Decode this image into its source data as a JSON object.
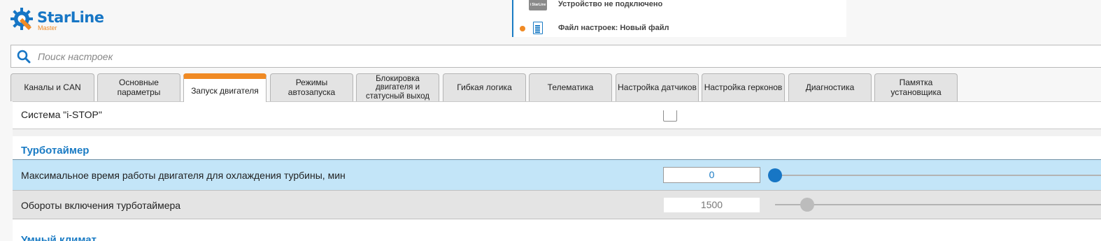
{
  "app": {
    "brand": "StarLine",
    "brand_sub": "Master",
    "brand_color": "#1776c5",
    "accent_color": "#f08a24"
  },
  "status": {
    "device_text": "Устройство не подключено",
    "device_icon_label": "i StarLine",
    "file_text": "Файл настроек: Новый файл"
  },
  "search": {
    "placeholder": "Поиск настроек",
    "value": ""
  },
  "tabs": [
    {
      "label": "Каналы и CAN",
      "active": false
    },
    {
      "label": "Основные параметры",
      "active": false
    },
    {
      "label": "Запуск двигателя",
      "active": true
    },
    {
      "label": "Режимы автозапуска",
      "active": false
    },
    {
      "label": "Блокировка двигателя и статусный выход",
      "active": false
    },
    {
      "label": "Гибкая логика",
      "active": false
    },
    {
      "label": "Телематика",
      "active": false
    },
    {
      "label": "Настройка датчиков",
      "active": false
    },
    {
      "label": "Настройка герконов",
      "active": false
    },
    {
      "label": "Диагностика",
      "active": false
    },
    {
      "label": "Памятка установщика",
      "active": false
    }
  ],
  "settings": {
    "istop": {
      "label": "Система \"i-STOP\"",
      "checked": false
    },
    "turbo_section": "Турботаймер",
    "turbo_time": {
      "label": "Максимальное время работы двигателя для охлаждения турбины, мин",
      "value": "0",
      "slider_fraction": 0.0
    },
    "turbo_rpm": {
      "label": "Обороты включения турботаймера",
      "value": "1500"
    },
    "next_section": "Умный климат"
  }
}
